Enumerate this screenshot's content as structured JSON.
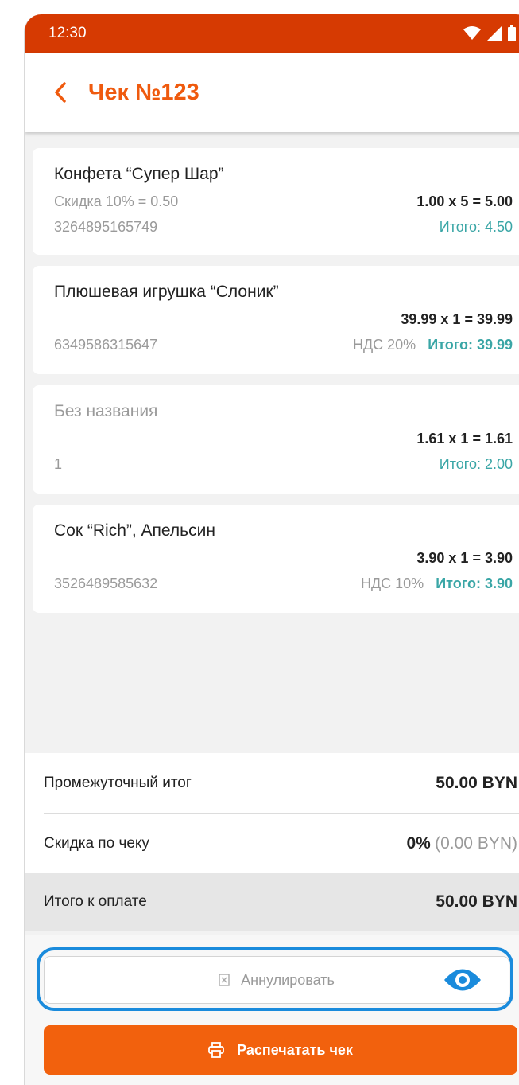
{
  "status_bar": {
    "time": "12:30",
    "icons": [
      "wifi-icon",
      "signal-icon",
      "battery-icon"
    ]
  },
  "header": {
    "back_icon": "chevron-left-icon",
    "title": "Чек №123"
  },
  "colors": {
    "status_bar": "#d63a02",
    "accent": "#ef5a0e",
    "total_teal": "#3aa6a6",
    "highlight_outline": "#1a8bdc",
    "print_button": "#f2610d"
  },
  "items": [
    {
      "name": "Конфета “Супер Шар”",
      "discount": "Скидка 10% = 0.50",
      "calc": "1.00 x 5 = 5.00",
      "code": "3264895165749",
      "vat": "",
      "total": "Итого: 4.50"
    },
    {
      "name": "Плюшевая игрушка “Слоник”",
      "calc": "39.99 x 1 = 39.99",
      "code": "6349586315647",
      "vat": "НДС 20%",
      "total": "Итого: 39.99"
    },
    {
      "name": "Без названия",
      "calc": "1.61 x 1 = 1.61",
      "code": "1",
      "vat": "",
      "total": "Итого: 2.00"
    },
    {
      "name": "Сок “Rich”, Апельсин",
      "calc": "3.90 x 1 = 3.90",
      "code": "3526489585632",
      "vat": "НДС 10%",
      "total": "Итого: 3.90"
    }
  ],
  "summary": {
    "subtotal_label": "Промежуточный итог",
    "subtotal_value": "50.00 BYN",
    "discount_label": "Скидка по чеку",
    "discount_percent": "0%",
    "discount_amount": "(0.00 BYN)",
    "total_label": "Итого к оплате",
    "total_value": "50.00 BYN"
  },
  "actions": {
    "cancel_label": "Аннулировать",
    "cancel_icon": "cancel-receipt-icon",
    "eye_icon": "eye-icon",
    "print_label": "Распечатать чек",
    "print_icon": "printer-icon"
  }
}
